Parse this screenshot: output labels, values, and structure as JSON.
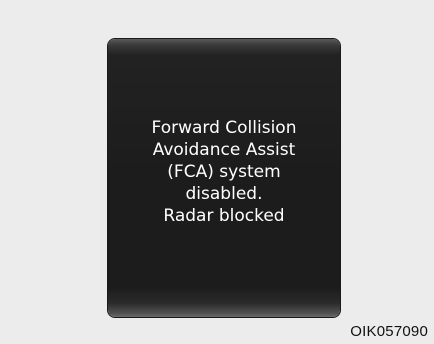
{
  "display": {
    "message_lines": [
      "Forward Collision",
      "Avoidance Assist",
      "(FCA) system",
      "disabled.",
      "Radar blocked"
    ]
  },
  "figure_code": "OIK057090",
  "colors": {
    "background": "#ececec",
    "display_fill": "#1c1c1c",
    "text": "#ffffff"
  }
}
